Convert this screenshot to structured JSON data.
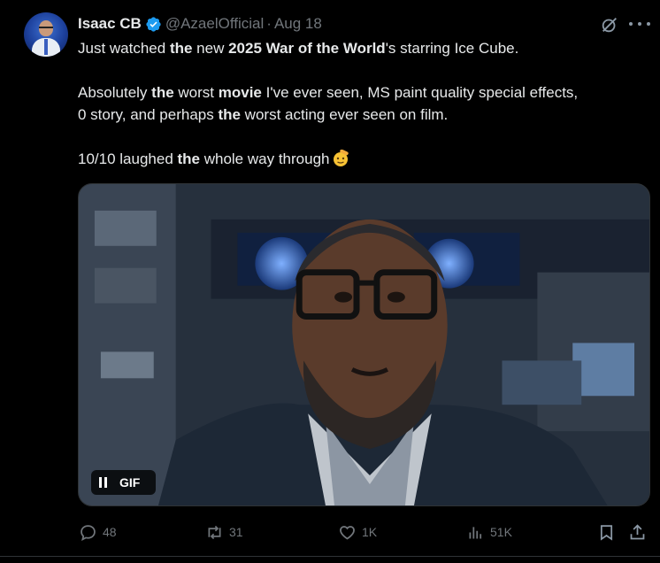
{
  "author": {
    "name": "Isaac CB",
    "handle": "@AzaelOfficial",
    "separator": "·",
    "date": "Aug 18",
    "verified_color": "#1d9bf0"
  },
  "tweet": {
    "line1": {
      "p1": "Just watched ",
      "b1": "the",
      "p2": " new ",
      "b2": "2025 War of the World",
      "p3": "'s starring Ice Cube."
    },
    "line2": {
      "p1": "Absolutely ",
      "b1": "the",
      "p2": " worst ",
      "b2": "movie",
      "p3": " I've ever seen, MS paint quality special effects,"
    },
    "line3": {
      "p1": "0 story, and perhaps ",
      "b1": "the",
      "p2": " worst acting ever seen on film."
    },
    "line4": {
      "p1": "10/10 laughed ",
      "b1": "the",
      "p2": " whole way through"
    },
    "emoji": "saluting-face-emoji"
  },
  "media": {
    "type": "gif",
    "badge_label": "GIF",
    "control_icon": "pause-icon"
  },
  "actions": {
    "replies": "48",
    "reposts": "31",
    "likes": "1K",
    "views": "51K",
    "bookmark_icon": "bookmark-icon",
    "share_icon": "share-icon"
  },
  "icons": [
    "grok-icon",
    "more-icon",
    "reply-icon",
    "repost-icon",
    "like-icon",
    "views-icon"
  ]
}
